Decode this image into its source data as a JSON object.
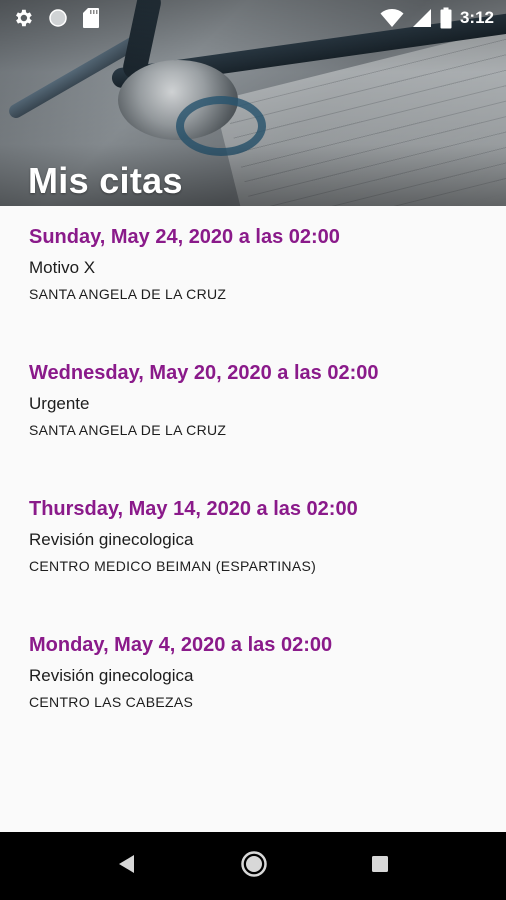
{
  "status_bar": {
    "time": "3:12",
    "icons": [
      "settings-icon",
      "circle-icon",
      "sd-card-icon",
      "wifi-icon",
      "signal-icon",
      "battery-icon"
    ]
  },
  "header": {
    "title": "Mis citas"
  },
  "appointments": [
    {
      "date": "Sunday, May 24, 2020 a las 02:00",
      "reason": "Motivo X",
      "center": "SANTA ANGELA DE LA CRUZ"
    },
    {
      "date": "Wednesday, May 20, 2020 a las 02:00",
      "reason": "Urgente",
      "center": "SANTA ANGELA DE LA CRUZ"
    },
    {
      "date": "Thursday, May 14, 2020 a las 02:00",
      "reason": "Revisión ginecologica",
      "center": "CENTRO MEDICO BEIMAN (ESPARTINAS)"
    },
    {
      "date": "Monday, May 4, 2020 a las 02:00",
      "reason": "Revisión ginecologica",
      "center": "CENTRO LAS CABEZAS"
    }
  ],
  "nav_bar": {
    "icons": [
      "back-icon",
      "home-icon",
      "recents-icon"
    ]
  },
  "colors": {
    "accent": "#8a1a8a",
    "text": "#1d1d1d",
    "background": "#fafafa",
    "nav_bar": "#000000"
  }
}
